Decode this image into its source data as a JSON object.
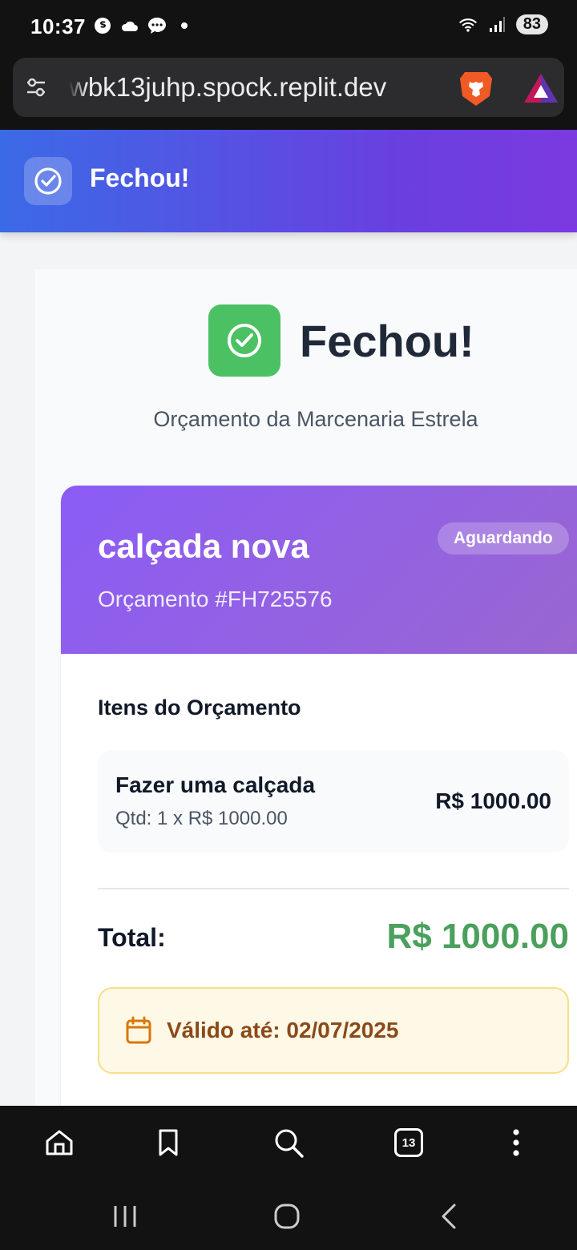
{
  "status_bar": {
    "time": "10:37",
    "battery": "83",
    "left_icons": [
      "sync-icon",
      "cloud-icon",
      "chat-icon",
      "dot-icon"
    ],
    "right_icons": [
      "wifi-icon",
      "signal-icon",
      "battery-icon"
    ]
  },
  "browser": {
    "url": "wbk13juhp.spock.replit.dev",
    "tab_count": "13"
  },
  "app": {
    "header_title": "Fechou!"
  },
  "hero": {
    "title": "Fechou!",
    "subtitle": "Orçamento da Marcenaria Estrela"
  },
  "quote": {
    "title": "calçada nova",
    "reference": "Orçamento #FH725576",
    "status": "Aguardando",
    "items_title": "Itens do Orçamento",
    "items": [
      {
        "name": "Fazer uma calçada",
        "qty": "Qtd: 1 x R$ 1000.00",
        "price": "R$ 1000.00"
      }
    ],
    "total_label": "Total:",
    "total_value": "R$ 1000.00",
    "validity": "Válido até: 02/07/2025"
  },
  "colors": {
    "header_gradient_start": "#3b6ae6",
    "header_gradient_end": "#7b3ae0",
    "success_green": "#4cc163",
    "total_green": "#4aa05c",
    "card_header": "#8b5cf6",
    "validity_text": "#8a4a18"
  }
}
